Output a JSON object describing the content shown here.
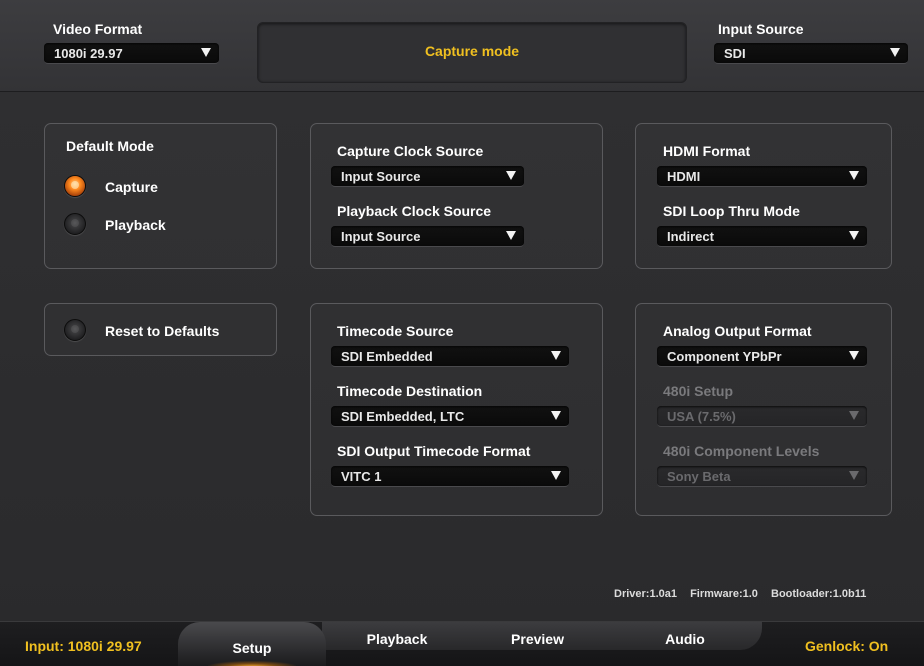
{
  "top": {
    "video_format_label": "Video Format",
    "video_format_value": "1080i 29.97",
    "mode_text": "Capture mode",
    "input_source_label": "Input Source",
    "input_source_value": "SDI"
  },
  "default_mode": {
    "title": "Default Mode",
    "options": [
      {
        "label": "Capture",
        "selected": true
      },
      {
        "label": "Playback",
        "selected": false
      }
    ]
  },
  "reset": {
    "label": "Reset to Defaults"
  },
  "clock": {
    "capture_label": "Capture Clock Source",
    "capture_value": "Input Source",
    "playback_label": "Playback Clock Source",
    "playback_value": "Input Source"
  },
  "hdmi": {
    "format_label": "HDMI Format",
    "format_value": "HDMI",
    "loop_label": "SDI Loop Thru Mode",
    "loop_value": "Indirect"
  },
  "timecode": {
    "source_label": "Timecode Source",
    "source_value": "SDI Embedded",
    "dest_label": "Timecode Destination",
    "dest_value": "SDI Embedded, LTC",
    "format_label": "SDI Output Timecode Format",
    "format_value": "VITC 1"
  },
  "analog": {
    "format_label": "Analog Output Format",
    "format_value": "Component YPbPr",
    "setup_label": "480i Setup",
    "setup_value": "USA (7.5%)",
    "levels_label": "480i Component Levels",
    "levels_value": "Sony Beta"
  },
  "versions": {
    "driver": "Driver:1.0a1",
    "firmware": "Firmware:1.0",
    "bootloader": "Bootloader:1.0b11"
  },
  "bottom": {
    "input_status": "Input: 1080i 29.97",
    "genlock_status": "Genlock: On",
    "tabs": [
      "Setup",
      "Playback",
      "Preview",
      "Audio"
    ],
    "active_tab": "Setup"
  },
  "colors": {
    "accent_yellow": "#f0c020",
    "radio_on": "#ff8a1f"
  }
}
